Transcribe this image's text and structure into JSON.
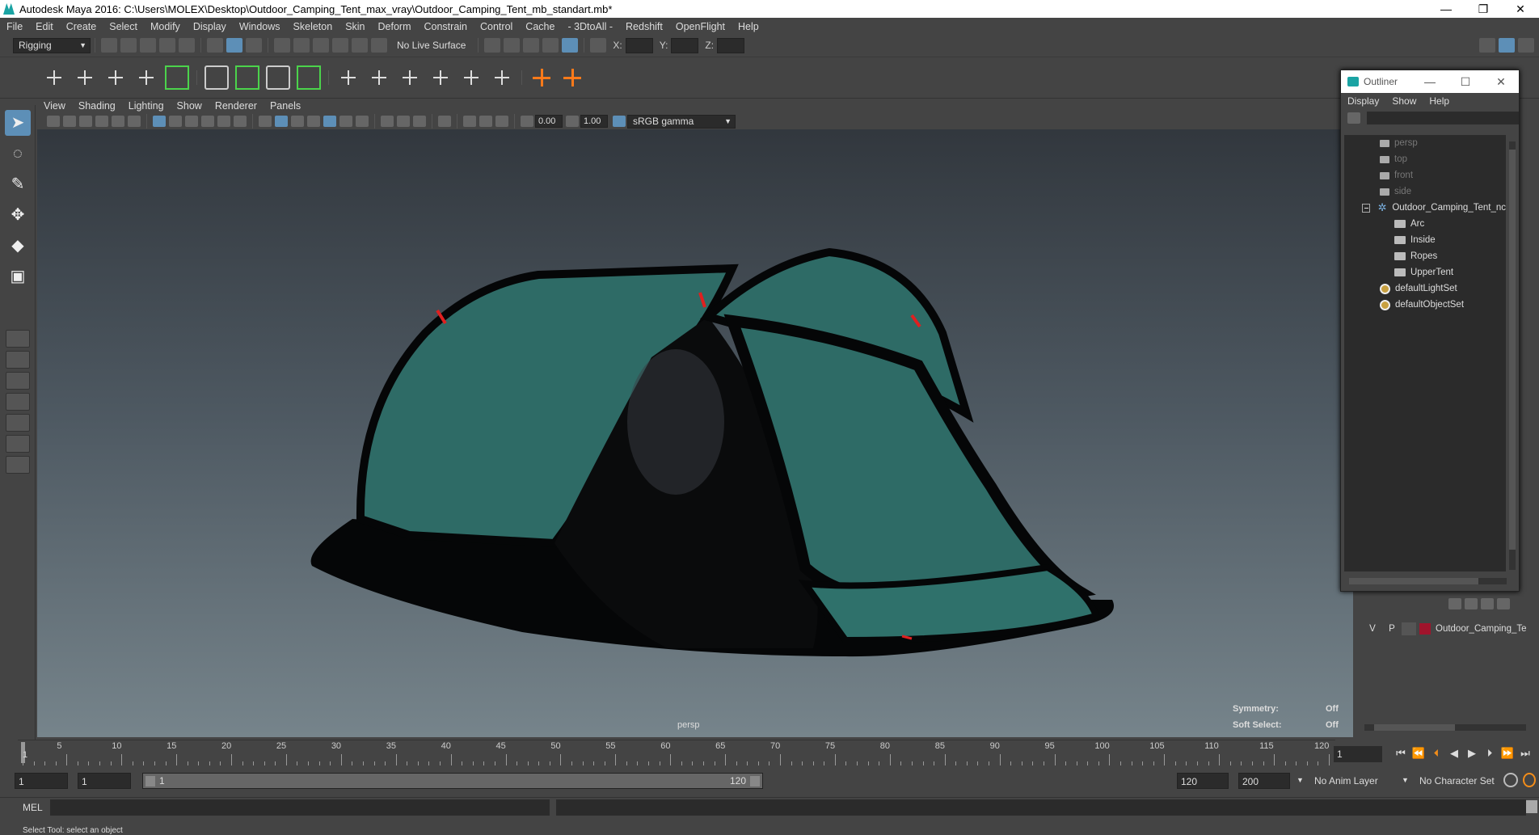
{
  "window": {
    "title": "Autodesk Maya 2016: C:\\Users\\MOLEX\\Desktop\\Outdoor_Camping_Tent_max_vray\\Outdoor_Camping_Tent_mb_standart.mb*",
    "controls": [
      "—",
      "❐",
      "✕"
    ]
  },
  "menubar": [
    "File",
    "Edit",
    "Create",
    "Select",
    "Modify",
    "Display",
    "Windows",
    "Skeleton",
    "Skin",
    "Deform",
    "Constrain",
    "Control",
    "Cache",
    "- 3DtoAll -",
    "Redshift",
    "OpenFlight",
    "Help"
  ],
  "toolbar": {
    "mode": "Rigging",
    "live_surface": "No Live Surface",
    "x_label": "X:",
    "y_label": "Y:",
    "z_label": "Z:"
  },
  "viewport": {
    "menu": [
      "View",
      "Shading",
      "Lighting",
      "Show",
      "Renderer",
      "Panels"
    ],
    "exposure": "0.00",
    "gamma": "1.00",
    "color_space": "sRGB gamma",
    "camera": "persp",
    "hud": {
      "symmetry_label": "Symmetry:",
      "symmetry_value": "Off",
      "soft_select_label": "Soft Select:",
      "soft_select_value": "Off"
    }
  },
  "outliner": {
    "title": "Outliner",
    "menu": [
      "Display",
      "Show",
      "Help"
    ],
    "items": [
      {
        "label": "persp",
        "dim": true
      },
      {
        "label": "top",
        "dim": true
      },
      {
        "label": "front",
        "dim": true
      },
      {
        "label": "side",
        "dim": true
      },
      {
        "label": "Outdoor_Camping_Tent_nc"
      },
      {
        "label": "Arc"
      },
      {
        "label": "Inside"
      },
      {
        "label": "Ropes"
      },
      {
        "label": "UpperTent"
      },
      {
        "label": "defaultLightSet"
      },
      {
        "label": "defaultObjectSet"
      }
    ]
  },
  "layers": {
    "v": "V",
    "p": "P",
    "name": "Outdoor_Camping_Te",
    "color": "#a0142c"
  },
  "timeline": {
    "ticks": [
      5,
      10,
      15,
      20,
      25,
      30,
      35,
      40,
      45,
      50,
      55,
      60,
      65,
      70,
      75,
      80,
      85,
      90,
      95,
      100,
      105,
      110,
      115,
      120
    ],
    "start_marker": "1",
    "current_frame": "1"
  },
  "range": {
    "start": "1",
    "playback_start": "1",
    "slider_start": "1",
    "slider_end": "120",
    "playback_end": "120",
    "end": "200",
    "anim_layer": "No Anim Layer",
    "character_set": "No Character Set"
  },
  "command": {
    "label": "MEL",
    "help": "Select Tool: select an object"
  },
  "colors": {
    "tent_fabric": "#2e6b66",
    "tent_dark": "#050607",
    "accent_red": "#e02020"
  }
}
